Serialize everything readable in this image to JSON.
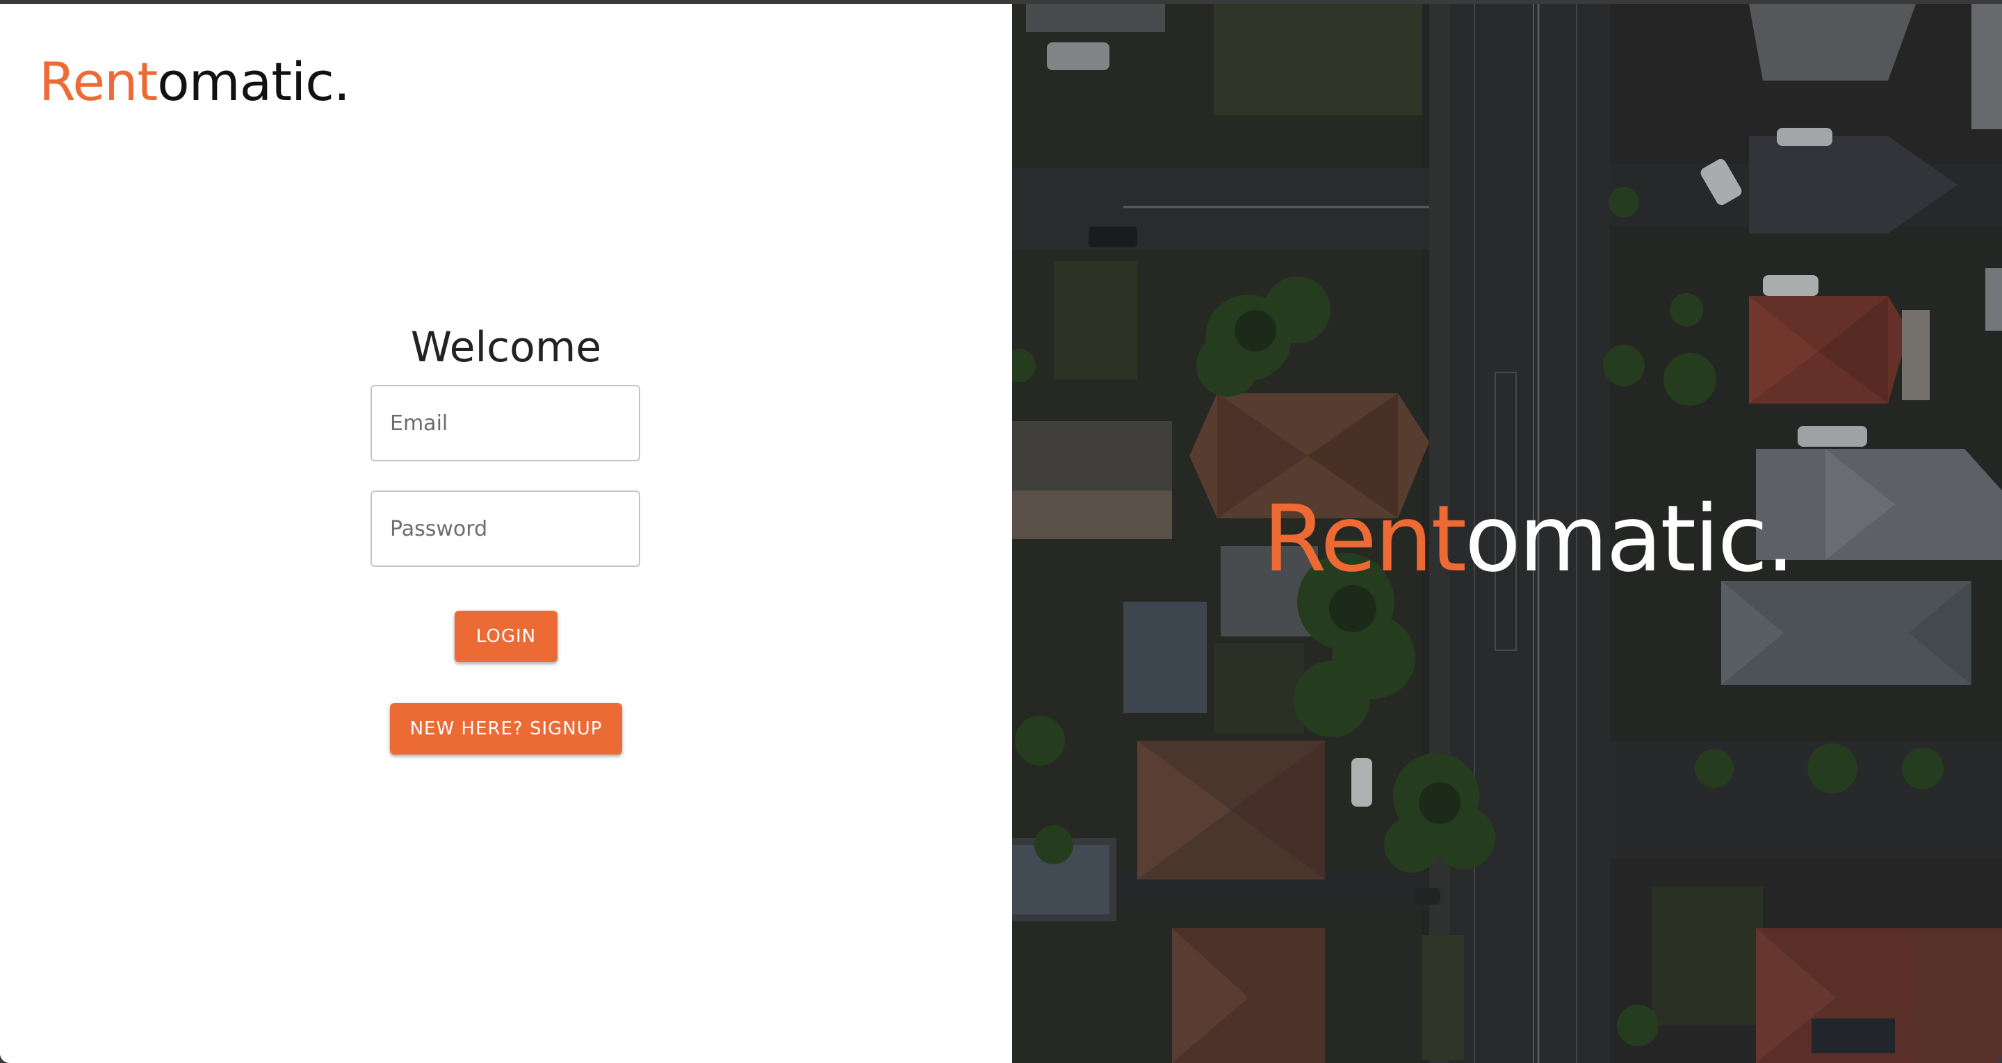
{
  "brand": {
    "name_accent": "Rent",
    "name_rest": "omatic.",
    "accent_color": "#ec6a34"
  },
  "login_form": {
    "heading": "Welcome",
    "email_placeholder": "Email",
    "password_placeholder": "Password",
    "login_label": "LOGIN",
    "signup_label": "NEW HERE? SIGNUP"
  },
  "hero": {
    "image": "aerial-neighbourhood-photo",
    "name_accent": "Rent",
    "name_rest": "omatic."
  }
}
